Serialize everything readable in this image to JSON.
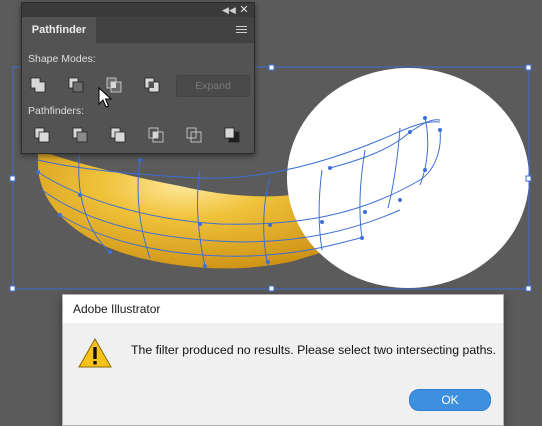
{
  "panel": {
    "tab_label": "Pathfinder",
    "shape_modes_label": "Shape Modes:",
    "pathfinders_label": "Pathfinders:",
    "expand_label": "Expand",
    "shape_mode_icons": [
      "unite-icon",
      "minus-front-icon",
      "intersect-icon",
      "exclude-icon"
    ],
    "pathfinder_icons": [
      "divide-icon",
      "trim-icon",
      "merge-icon",
      "crop-icon",
      "outline-icon",
      "minus-back-icon"
    ]
  },
  "dialog": {
    "title": "Adobe Illustrator",
    "message": "The filter produced no results. Please select two intersecting paths.",
    "ok_label": "OK"
  },
  "colors": {
    "selection": "#3d6fd6",
    "banana": "#e9b52c",
    "accent": "#3d8fe0"
  }
}
